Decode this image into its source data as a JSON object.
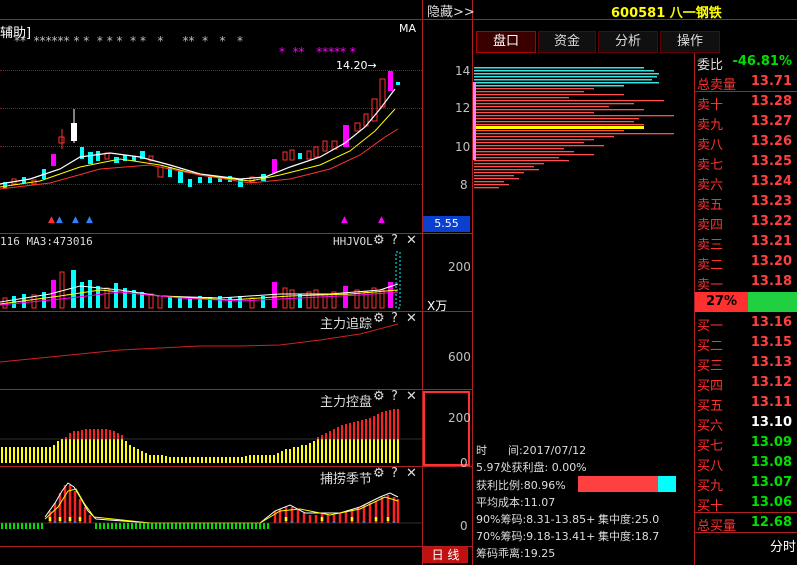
{
  "top": {
    "hide_label": "隐藏>>",
    "stock_code_name": "600581 八一钢铁"
  },
  "tabs": [
    "盘口",
    "资金",
    "分析",
    "操作"
  ],
  "main_chart": {
    "title": "辅助]",
    "ma_label": "MA",
    "peak_label": "14.20→",
    "y_ticks": [
      "14",
      "12",
      "10",
      "8"
    ],
    "price_box": "5.55",
    "star_row_white": "**  ****** * *  * * *  * *   *     **  *   *   *",
    "star_row_magenta": "*  **   ***** *"
  },
  "volume_panel": {
    "label_left": "116  MA3:473016",
    "label_right": "HHJVOL",
    "y_tick": "200",
    "unit": "X万"
  },
  "panel_zhuizong": {
    "label": "主力追踪",
    "y_tick": "600"
  },
  "panel_kongpan": {
    "label": "主力控盘",
    "y_tick_top": "200",
    "y_tick_bottom": "0"
  },
  "panel_buliao": {
    "label": "捕捞季节",
    "y_tick": "0"
  },
  "bottom_tab": "日 线",
  "panel_controls": {
    "gear": "⚙",
    "help": "?",
    "close": "✕"
  },
  "chip_info": {
    "time_label": "时      间:2017/07/12",
    "profit_line": "5.97处获利盘: 0.00%",
    "profit_ratio": "获利比例:80.96%",
    "avg_cost": "平均成本:11.07",
    "chip90": "90%筹码:8.31-13.85+",
    "conc90": "集中度:25.0",
    "chip70": "70%筹码:9.18-13.41+",
    "conc70": "集中度:18.7",
    "deviation": "筹码乖离:19.25"
  },
  "order_book": {
    "weibi_label": "委比",
    "weibi_value": "-46.81%",
    "total_sell_label": "总卖量",
    "total_sell_value": "13.71",
    "sells": [
      {
        "label": "卖十",
        "value": "13.28"
      },
      {
        "label": "卖九",
        "value": "13.27"
      },
      {
        "label": "卖八",
        "value": "13.26"
      },
      {
        "label": "卖七",
        "value": "13.25"
      },
      {
        "label": "卖六",
        "value": "13.24"
      },
      {
        "label": "卖五",
        "value": "13.23"
      },
      {
        "label": "卖四",
        "value": "13.22"
      },
      {
        "label": "卖三",
        "value": "13.21"
      },
      {
        "label": "卖二",
        "value": "13.20"
      },
      {
        "label": "卖一",
        "value": "13.18"
      }
    ],
    "ratio": "27%",
    "buys": [
      {
        "label": "买一",
        "value": "13.16"
      },
      {
        "label": "买二",
        "value": "13.15"
      },
      {
        "label": "买三",
        "value": "13.13"
      },
      {
        "label": "买四",
        "value": "13.12"
      },
      {
        "label": "买五",
        "value": "13.11"
      },
      {
        "label": "买六",
        "value": "13.10"
      },
      {
        "label": "买七",
        "value": "13.09"
      },
      {
        "label": "买八",
        "value": "13.08"
      },
      {
        "label": "买九",
        "value": "13.07"
      },
      {
        "label": "买十",
        "value": "13.06"
      }
    ],
    "total_buy_label": "总买量",
    "total_buy_value": "12.68",
    "footer": "分时"
  },
  "colors": {
    "up": "#ff3030",
    "down": "#00ffff",
    "grid": "#b02020",
    "accent": "#ffff00"
  }
}
